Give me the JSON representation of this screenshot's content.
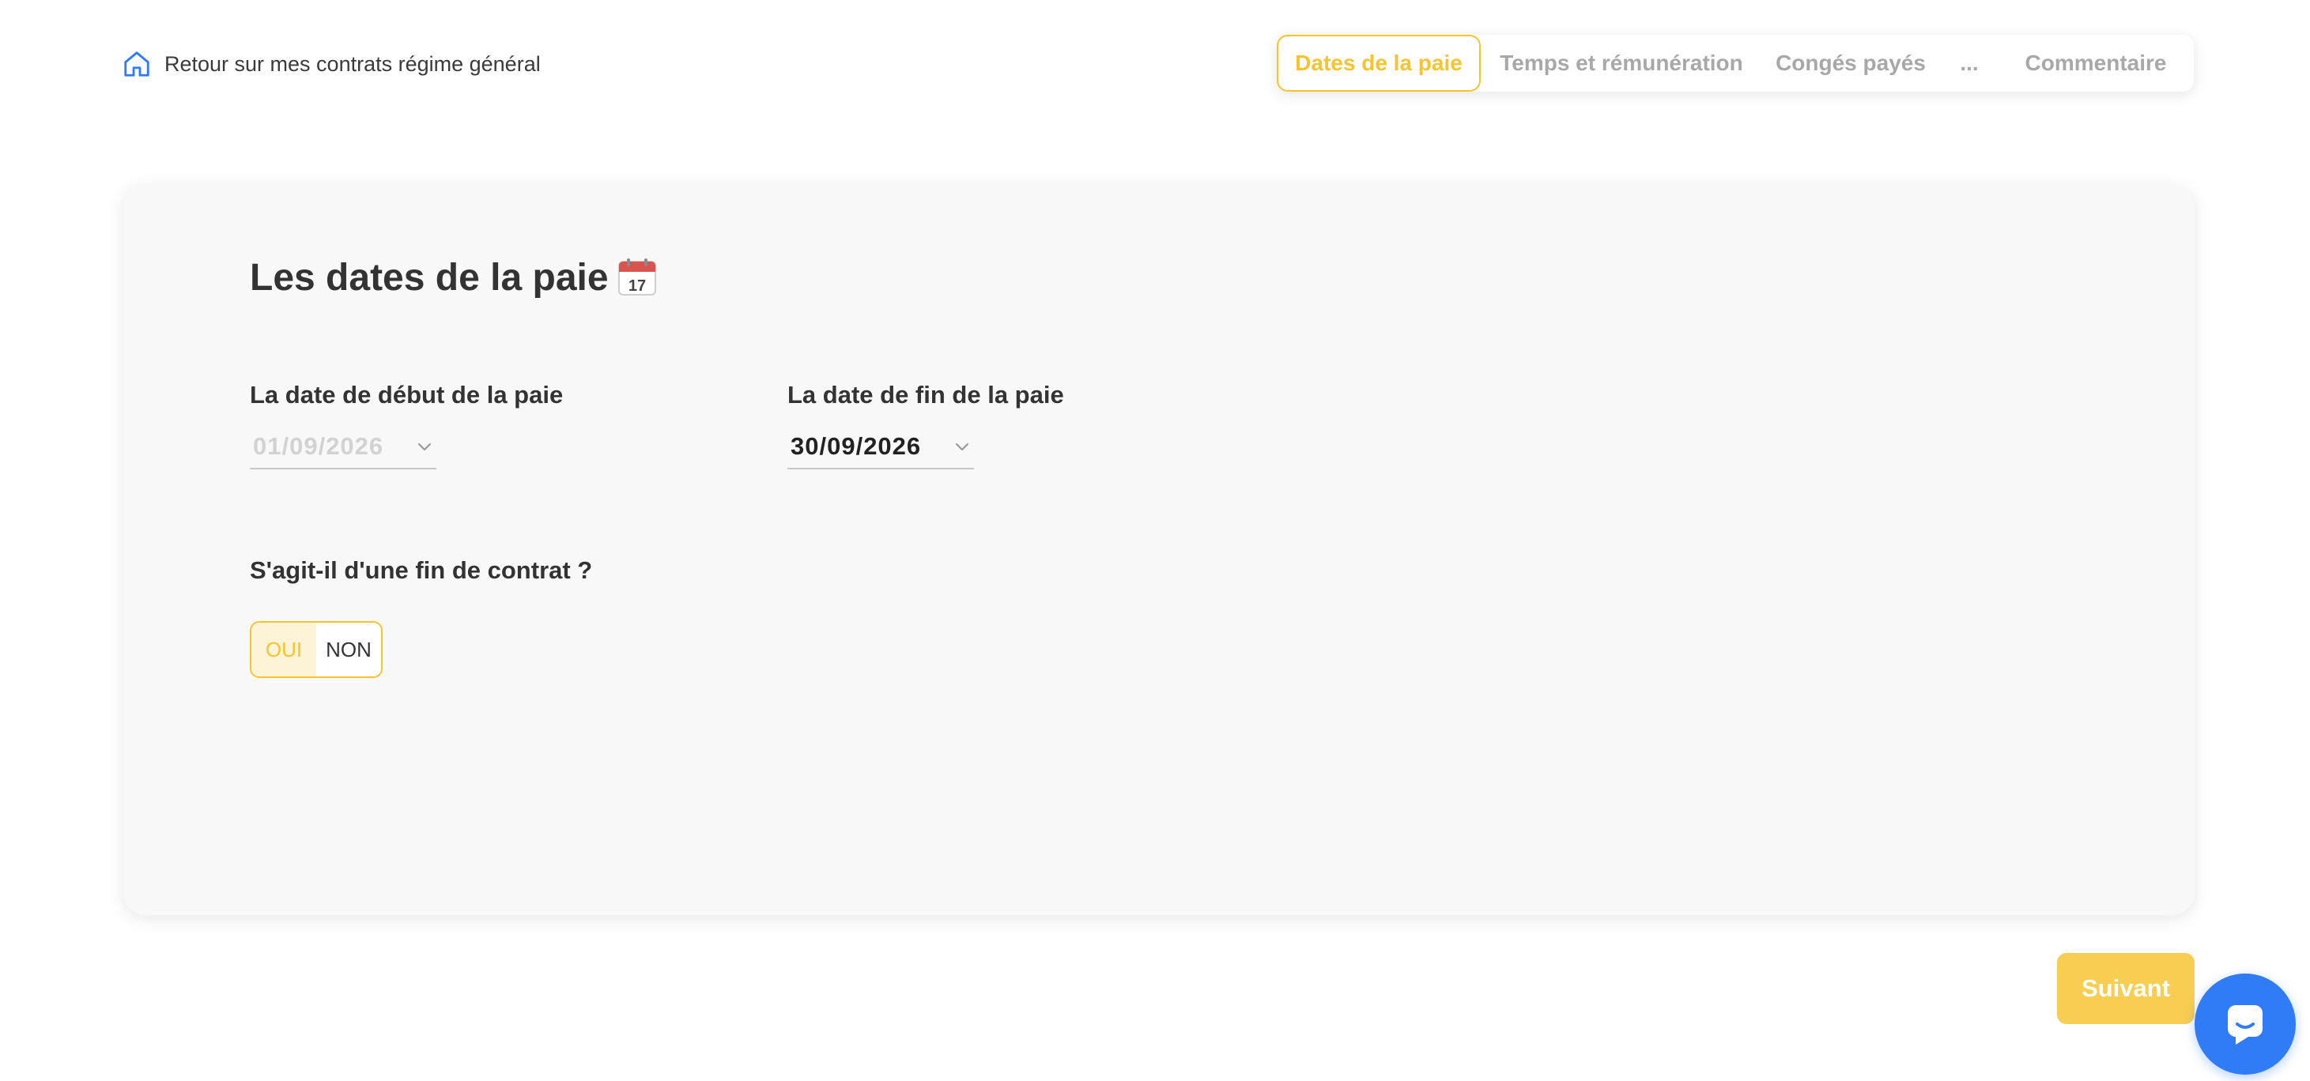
{
  "header": {
    "back_link": {
      "label": "Retour sur mes contrats régime général",
      "icon": "home-icon"
    },
    "steps": [
      {
        "label": "Dates de la paie",
        "active": true
      },
      {
        "label": "Temps et rémunération",
        "active": false
      },
      {
        "label": "Congés payés",
        "active": false
      },
      {
        "label": "...",
        "active": false
      },
      {
        "label": "Commentaire",
        "active": false
      }
    ]
  },
  "card": {
    "title": "Les dates de la paie",
    "title_icon": "calendar-icon",
    "calendar_day": "17",
    "start_date": {
      "label": "La date de début de la paie",
      "value": "01/09/2026",
      "disabled": true
    },
    "end_date": {
      "label": "La date de fin de la paie",
      "value": "30/09/2026",
      "disabled": false
    },
    "end_of_contract": {
      "question": "S'agit-il d'une fin de contrat ?",
      "options": [
        "OUI",
        "NON"
      ],
      "selected": "OUI"
    }
  },
  "footer": {
    "next_label": "Suivant",
    "chat_icon": "chat-icon"
  },
  "colors": {
    "accent": "#f7c32f",
    "button": "#f7cd52",
    "chat": "#2f7cf6",
    "home_icon": "#2f7cf6"
  }
}
